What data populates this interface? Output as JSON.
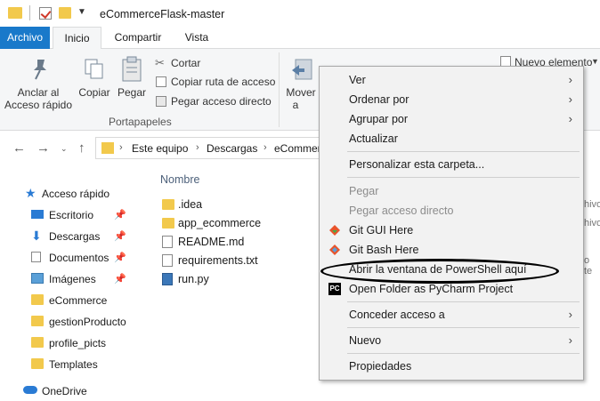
{
  "window": {
    "title": "eCommerceFlask-master"
  },
  "ribbon": {
    "tabs": [
      "Archivo",
      "Inicio",
      "Compartir",
      "Vista"
    ],
    "anclar_label_1": "Anclar al",
    "anclar_label_2": "Acceso rápido",
    "copiar_label": "Copiar",
    "pegar_label": "Pegar",
    "cortar_label": "Cortar",
    "copiar_ruta_label": "Copiar ruta de acceso",
    "pegar_acceso_label": "Pegar acceso directo",
    "portapapeles_label": "Portapapeles",
    "mover_label_1": "Mover",
    "mover_label_2": "a",
    "nuevo_elemento_label": "Nuevo elemento"
  },
  "address": {
    "crumbs": [
      "Este equipo",
      "Descargas",
      "eCommerce"
    ]
  },
  "navpane": {
    "items": [
      {
        "label": "Acceso rápido",
        "icon": "star-icon",
        "pinned": false
      },
      {
        "label": "Escritorio",
        "icon": "desktop-icon",
        "pinned": true
      },
      {
        "label": "Descargas",
        "icon": "download-icon",
        "pinned": true
      },
      {
        "label": "Documentos",
        "icon": "document-icon",
        "pinned": true
      },
      {
        "label": "Imágenes",
        "icon": "image-icon",
        "pinned": true
      },
      {
        "label": "eCommerce",
        "icon": "folder-icon",
        "pinned": false
      },
      {
        "label": "gestionProducto",
        "icon": "folder-icon",
        "pinned": false
      },
      {
        "label": "profile_picts",
        "icon": "folder-icon",
        "pinned": false
      },
      {
        "label": "Templates",
        "icon": "folder-icon",
        "pinned": false
      },
      {
        "label": "OneDrive",
        "icon": "cloud-icon",
        "pinned": false
      }
    ]
  },
  "content": {
    "column_name": "Nombre",
    "files": [
      {
        "name": ".idea",
        "icon": "folder-icon"
      },
      {
        "name": "app_ecommerce",
        "icon": "folder-icon"
      },
      {
        "name": "README.md",
        "icon": "file-icon"
      },
      {
        "name": "requirements.txt",
        "icon": "text-file-icon"
      },
      {
        "name": "run.py",
        "icon": "python-file-icon"
      }
    ],
    "partial_right_1": "hivo",
    "partial_right_2": "hivo",
    "partial_right_3": "o te"
  },
  "context_menu": {
    "items": {
      "ver": "Ver",
      "ordenar": "Ordenar por",
      "agrupar": "Agrupar por",
      "actualizar": "Actualizar",
      "personalizar": "Personalizar esta carpeta...",
      "pegar": "Pegar",
      "pegar_acceso": "Pegar acceso directo",
      "git_gui": "Git GUI Here",
      "git_bash": "Git Bash Here",
      "powershell": "Abrir la ventana de PowerShell aquí",
      "pycharm": "Open Folder as PyCharm Project",
      "conceder": "Conceder acceso a",
      "nuevo": "Nuevo",
      "propiedades": "Propiedades"
    }
  },
  "colors": {
    "accent": "#1979ca",
    "folder": "#f2c94c",
    "menu_bg": "#f2f2f2"
  }
}
